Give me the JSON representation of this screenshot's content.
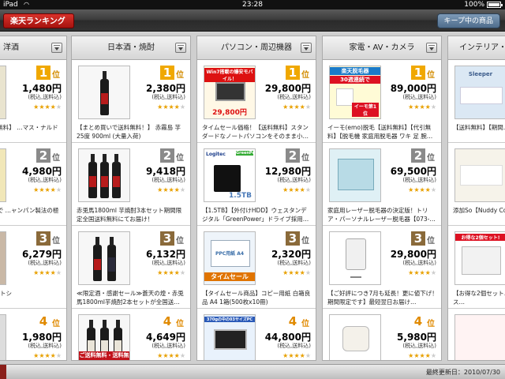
{
  "status": {
    "carrier": "iPad",
    "time": "23:28",
    "battery": "100%",
    "battery_level": 1.0
  },
  "nav": {
    "ranking_label": "楽天ランキング",
    "keep_label": "キープ中の商品"
  },
  "footer": {
    "updated": "最終更新日：2010/07/30"
  },
  "tax_text": "(税込,送料込)",
  "columns": [
    {
      "title": "・洋酒",
      "items": [
        {
          "rank": "1",
          "suffix": "位",
          "price": "1,480円",
          "stars": 4,
          "title": "予定です】【送料無料】 …マス・ナルドー 【正規"
        },
        {
          "rank": "2",
          "suffix": "位",
          "price": "4,980円",
          "stars": 4,
          "title": "限り！1本830円で …ャンパン製法の極上…"
        },
        {
          "rank": "3",
          "suffix": "位",
          "price": "6,279円",
          "stars": 4,
          "title": "パロン・ド・ロートシ"
        },
        {
          "rank": "4",
          "suffix": "位",
          "price": "1,980円",
          "stars": 4,
          "title": ""
        }
      ]
    },
    {
      "title": "日本酒・焼酎",
      "items": [
        {
          "rank": "1",
          "suffix": "位",
          "price": "2,380円",
          "stars": 4,
          "title": "【まとめ買いで送料無料！】 赤霧島 芋 25度 900ml (大量入荷)"
        },
        {
          "rank": "2",
          "suffix": "位",
          "price": "9,418円",
          "stars": 4,
          "title": "赤兎馬1800ml 芋焼酎3本セット期間限定全国送料無料にてお届け！"
        },
        {
          "rank": "3",
          "suffix": "位",
          "price": "6,132円",
          "stars": 4,
          "title": "≪限定酒・感謝セール≫蒼天の煌・赤兎馬1800ml芋焼酎2本セットが全国送…"
        },
        {
          "rank": "4",
          "suffix": "位",
          "price": "4,649円",
          "stars": 4,
          "title": ""
        }
      ]
    },
    {
      "title": "パソコン・周辺機器",
      "items": [
        {
          "rank": "1",
          "suffix": "位",
          "price": "29,800円",
          "stars": 4,
          "title": "タイムセール価格！【送料無料】スタンダードなノートパソコンをそのまま小…"
        },
        {
          "rank": "2",
          "suffix": "位",
          "price": "12,980円",
          "stars": 4,
          "title": "【1.5TB】【外付けHDD】ウェスタンデジタル「GreenPower」ドライブ採用…"
        },
        {
          "rank": "3",
          "suffix": "位",
          "price": "2,320円",
          "stars": 4,
          "title": "【タイムセール商品】コピー用紙 白箱良品 A4 1箱(500枚x10冊)"
        },
        {
          "rank": "4",
          "suffix": "位",
          "price": "44,800円",
          "stars": 4,
          "title": ""
        }
      ]
    },
    {
      "title": "家電・AV・カメラ",
      "items": [
        {
          "rank": "1",
          "suffix": "位",
          "price": "89,000円",
          "stars": 4,
          "title": "イーモ(emo)脱毛【送料無料】【代引無料】【脱毛機 家庭用脱毛器 ワキ 足 腕…"
        },
        {
          "rank": "2",
          "suffix": "位",
          "price": "69,500円",
          "stars": 4,
          "title": "家庭用レーザー脱毛器の決定版！トリア・パーソナルレーザー脱毛器【073-…"
        },
        {
          "rank": "3",
          "suffix": "位",
          "price": "29,800円",
          "stars": 4,
          "title": "【ご好評につき7月も延長！更に値下げ！期間限定です】最短翌日お届け…"
        },
        {
          "rank": "4",
          "suffix": "位",
          "price": "5,980円",
          "stars": 4,
          "title": ""
        }
      ]
    },
    {
      "title": "インテリア・",
      "items": [
        {
          "rank": "1",
          "suffix": "位",
          "price": "",
          "stars": 0,
          "title": "【送料無料】【期間…トルース…"
        },
        {
          "rank": "2",
          "suffix": "位",
          "price": "",
          "stars": 0,
          "title": "添加So【Nuddy Cot…"
        },
        {
          "rank": "3",
          "suffix": "位",
          "price": "",
          "stars": 0,
          "title": "【お得な2個セット…ラク引き出しチェス…"
        },
        {
          "rank": "4",
          "suffix": "位",
          "price": "",
          "stars": 0,
          "title": ""
        }
      ]
    }
  ],
  "thumb_texts": {
    "pc1_banner": "Win7搭載の爆安モバイル！",
    "pc1_price": "29,800円",
    "hdd_brand": "Logitec",
    "hdd_tag": "GreenPower",
    "hdd_size": "1.5TB",
    "paper_label": "PPC用紙 A4",
    "paper_sale": "タイムセール",
    "kaden1_top": "楽天脱毛器",
    "kaden1_mid": "30週連続で",
    "kaden1_bottom": "イーモ第1位",
    "sake4_label": "ご送料無料・送料無料",
    "pc4_banner": "370gの中の03サイズPC",
    "interior1": "Sleeper",
    "interior3": "お得な2個セット!"
  },
  "colors": {
    "accent_red": "#b2151a",
    "star": "#e8a000",
    "rank1": "#f0a800"
  }
}
